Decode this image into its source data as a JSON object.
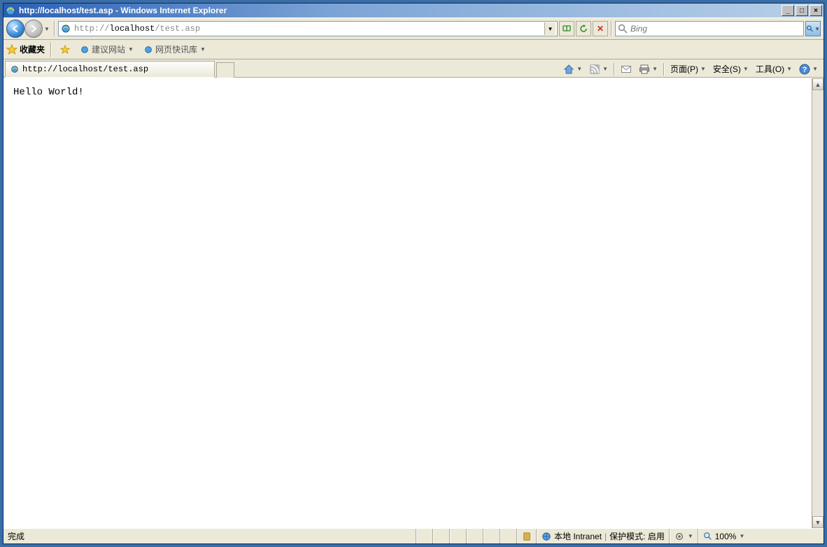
{
  "titlebar": {
    "title": "http://localhost/test.asp - Windows Internet Explorer"
  },
  "window_controls": {
    "minimize": "_",
    "maximize": "□",
    "close": "×"
  },
  "nav": {
    "url_prefix": "http://",
    "url_host": "localhost",
    "url_path": "/test.asp",
    "search_placeholder": "Bing"
  },
  "favbar": {
    "label": "收藏夹",
    "item1": "建议网站",
    "item2": "网页快讯库"
  },
  "tab": {
    "label": "http://localhost/test.asp"
  },
  "commandbar": {
    "page": "页面(P)",
    "safety": "安全(S)",
    "tools": "工具(O)"
  },
  "page": {
    "body": "Hello World!"
  },
  "statusbar": {
    "done": "完成",
    "zone": "本地 Intranet",
    "protected_mode": "保护模式: 启用",
    "zoom": "100%"
  }
}
